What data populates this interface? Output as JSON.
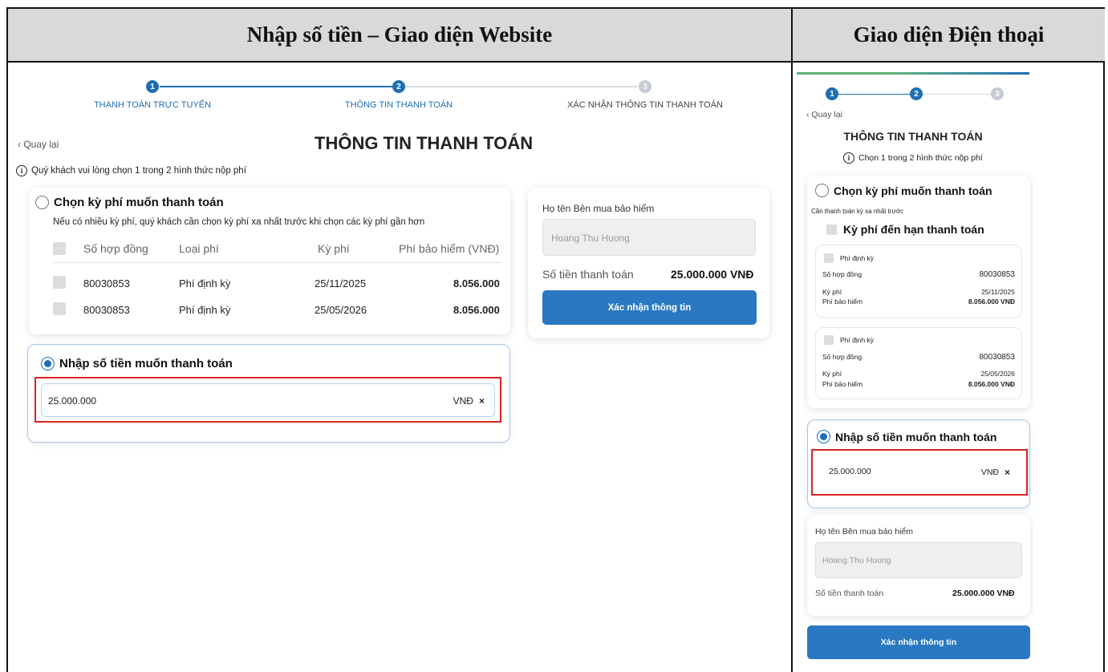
{
  "headers": {
    "left": "Nhập số tiền – Giao diện Website",
    "right": "Giao diện Điện thoại"
  },
  "web": {
    "steps": [
      {
        "num": "1",
        "label": "THANH TOÁN TRỰC TUYẾN",
        "state": "active"
      },
      {
        "num": "2",
        "label": "THÔNG TIN THANH TOÁN",
        "state": "active"
      },
      {
        "num": "3",
        "label": "XÁC NHẬN THÔNG TIN THANH TOÁN",
        "state": "idle"
      }
    ],
    "back": "Quay lại",
    "title": "THÔNG TIN THANH TOÁN",
    "info": "Quý khách vui lòng chọn 1 trong 2 hình thức nộp phí",
    "option1": {
      "title": "Chọn kỳ phí muốn thanh toán",
      "note": "Nếu có nhiều kỳ phí, quý khách cần chọn kỳ phí xa nhất trước khi chọn các kỳ phí gần hơn",
      "columns": [
        "Số hợp đồng",
        "Loại phí",
        "Kỳ phí",
        "Phí bảo hiểm (VNĐ)"
      ],
      "rows": [
        {
          "contract": "80030853",
          "type": "Phí định kỳ",
          "period": "25/11/2025",
          "amount": "8.056.000"
        },
        {
          "contract": "80030853",
          "type": "Phí định kỳ",
          "period": "25/05/2026",
          "amount": "8.056.000"
        }
      ]
    },
    "option2": {
      "title": "Nhập số tiền muốn thanh toán",
      "value": "25.000.000",
      "unit": "VNĐ",
      "clear": "×"
    },
    "summary": {
      "name_label": "Họ tên Bên mua bảo hiểm",
      "name_value": "Hoang Thu Huong",
      "total_label": "Số tiền thanh toán",
      "total_value": "25.000.000 VNĐ",
      "confirm": "Xác nhận thông tin"
    }
  },
  "mobile": {
    "steps": [
      "1",
      "2",
      "3"
    ],
    "back": "Quay lại",
    "title": "THÔNG TIN THANH TOÁN",
    "info": "Chọn 1 trong 2 hình thức nộp phí",
    "option1": {
      "title": "Chọn kỳ phí muốn thanh toán",
      "note": "Cần thanh toán kỳ xa nhất trước",
      "due_label": "Kỳ phí đến hạn thanh toán",
      "items": [
        {
          "type": "Phí định kỳ",
          "contract_label": "Số hợp đồng",
          "contract": "80030853",
          "period_label": "Kỳ phí",
          "period": "25/11/2025",
          "amount_label": "Phí bảo hiểm",
          "amount": "8.056.000 VNĐ"
        },
        {
          "type": "Phí định kỳ",
          "contract_label": "Số hợp đồng",
          "contract": "80030853",
          "period_label": "Kỳ phí",
          "period": "25/05/2026",
          "amount_label": "Phí bảo hiểm",
          "amount": "8.056.000 VNĐ"
        }
      ]
    },
    "option2": {
      "title": "Nhập số tiền muốn thanh toán",
      "value": "25.000.000",
      "unit": "VNĐ",
      "clear": "×"
    },
    "summary": {
      "name_label": "Họ tên Bên mua bảo hiểm",
      "name_value": "Hoang Thu Huong",
      "total_label": "Số tiền thanh toán",
      "total_value": "25.000.000 VNĐ",
      "confirm": "Xác nhận thông tin"
    }
  },
  "colors": {
    "primary": "#1e6fb5",
    "button": "#2a78c2",
    "highlight": "#dd2222",
    "header_bg": "#d9d9d9"
  }
}
